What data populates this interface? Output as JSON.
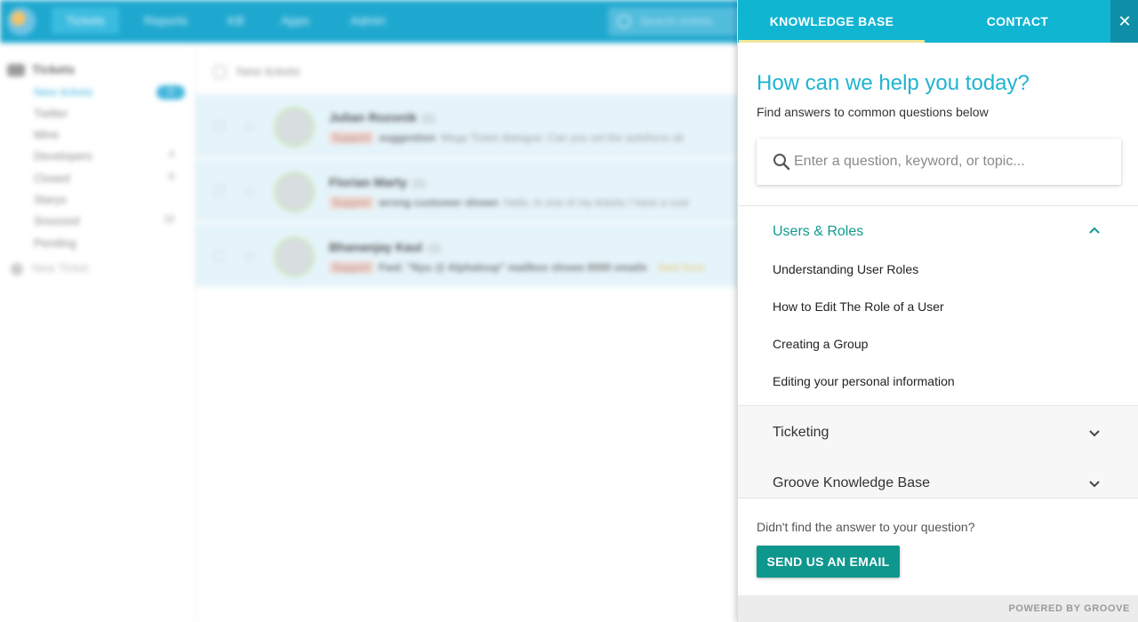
{
  "background_app": {
    "nav": [
      "Tickets",
      "Reports",
      "KB",
      "Apps",
      "Admin"
    ],
    "search_placeholder": "Search tickets",
    "sidebar": {
      "heading": "Tickets",
      "items": [
        {
          "label": "New tickets",
          "count": ""
        },
        {
          "label": "Twitter",
          "count": ""
        },
        {
          "label": "Mine",
          "count": ""
        },
        {
          "label": "Developers",
          "count": "4"
        },
        {
          "label": "Closed",
          "count": "8"
        },
        {
          "label": "Starys",
          "count": ""
        },
        {
          "label": "Snoozed",
          "count": "18"
        },
        {
          "label": "Pending",
          "count": ""
        }
      ],
      "active_badge": "3",
      "new_ticket": "New Ticket"
    },
    "list_title": "New tickets",
    "tickets": [
      {
        "name": "Julian Rozonik",
        "count": "(1)",
        "tag": "Support",
        "subject": "suggestion",
        "snippet": "Mega Ticket dialogue: Can you set the autoforce ali"
      },
      {
        "name": "Florian Marty",
        "count": "(1)",
        "tag": "Support",
        "subject": "wrong customer shown",
        "snippet": "Hello, in one of my tickets I have a cust"
      },
      {
        "name": "Bhananjay Kaul",
        "count": "(1)",
        "tag": "Support",
        "subject": "Fwd: \"Nyu @ Alphaloop\" mailbox shows 6000 emails",
        "snippet": "",
        "note": "Sent from"
      }
    ]
  },
  "panel": {
    "tabs": [
      "KNOWLEDGE BASE",
      "CONTACT"
    ],
    "close_glyph": "✕",
    "title": "How can we help you today?",
    "subtitle": "Find answers to common questions below",
    "search_placeholder": "Enter a question, keyword, or topic...",
    "sections": [
      {
        "title": "Users & Roles",
        "expanded": true,
        "articles": [
          "Understanding User Roles",
          "How to Edit The Role of a User",
          "Creating a Group",
          "Editing your personal information"
        ]
      },
      {
        "title": "Ticketing",
        "expanded": false,
        "articles": []
      },
      {
        "title": "Groove Knowledge Base",
        "expanded": false,
        "articles": []
      }
    ],
    "footer_question": "Didn't find the answer to your question?",
    "email_button": "SEND US AN EMAIL",
    "powered_by": "POWERED BY GROOVE"
  },
  "colors": {
    "brand_teal": "#10b5d2",
    "accent_green": "#0e978d",
    "tab_underline": "#f1e79a"
  }
}
